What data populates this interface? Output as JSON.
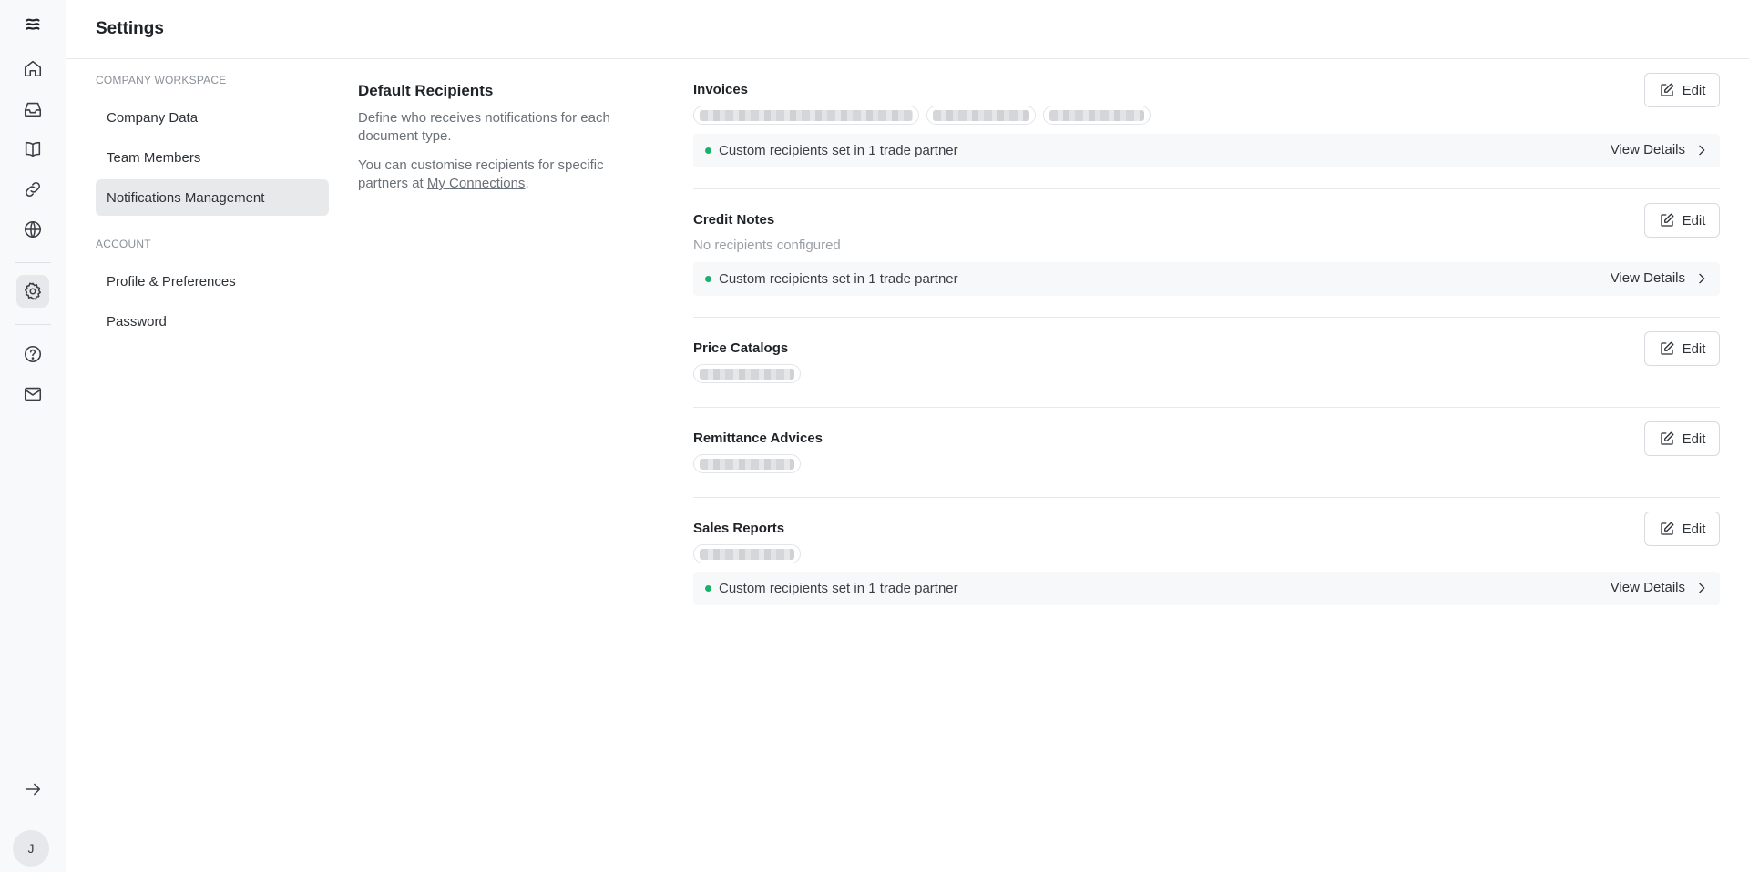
{
  "rail": {
    "icons": [
      "logo-icon",
      "home-icon",
      "inbox-icon",
      "book-icon",
      "link-icon",
      "globe-icon",
      "gear-icon",
      "help-icon",
      "mail-icon",
      "collapse-arrow-icon"
    ],
    "avatar_initial": "J"
  },
  "header": {
    "title": "Settings"
  },
  "sidebar": {
    "section_company": "COMPANY WORKSPACE",
    "section_account": "ACCOUNT",
    "items": [
      {
        "label": "Company Data",
        "active": false
      },
      {
        "label": "Team Members",
        "active": false
      },
      {
        "label": "Notifications Management",
        "active": true
      },
      {
        "label": "Profile & Preferences",
        "active": false
      },
      {
        "label": "Password",
        "active": false
      }
    ]
  },
  "description": {
    "title": "Default Recipients",
    "line1": "Define who receives notifications for each document type.",
    "line2_prefix": "You can customise recipients for specific partners at ",
    "line2_link": "My Connections",
    "line2_suffix": "."
  },
  "documents": [
    {
      "title": "Invoices",
      "recipients_count": 3,
      "custom_text": "Custom recipients set in 1 trade partner",
      "view_details": "View Details",
      "edit_label": "Edit"
    },
    {
      "title": "Credit Notes",
      "empty_text": "No recipients configured",
      "custom_text": "Custom recipients set in 1 trade partner",
      "view_details": "View Details",
      "edit_label": "Edit"
    },
    {
      "title": "Price Catalogs",
      "recipients_count": 1,
      "edit_label": "Edit"
    },
    {
      "title": "Remittance Advices",
      "recipients_count": 1,
      "edit_label": "Edit"
    },
    {
      "title": "Sales Reports",
      "recipients_count": 1,
      "custom_text": "Custom recipients set in 1 trade partner",
      "view_details": "View Details",
      "edit_label": "Edit"
    }
  ],
  "colors": {
    "accent_green": "#1fae6b",
    "active_bg": "#e8e9eb"
  }
}
